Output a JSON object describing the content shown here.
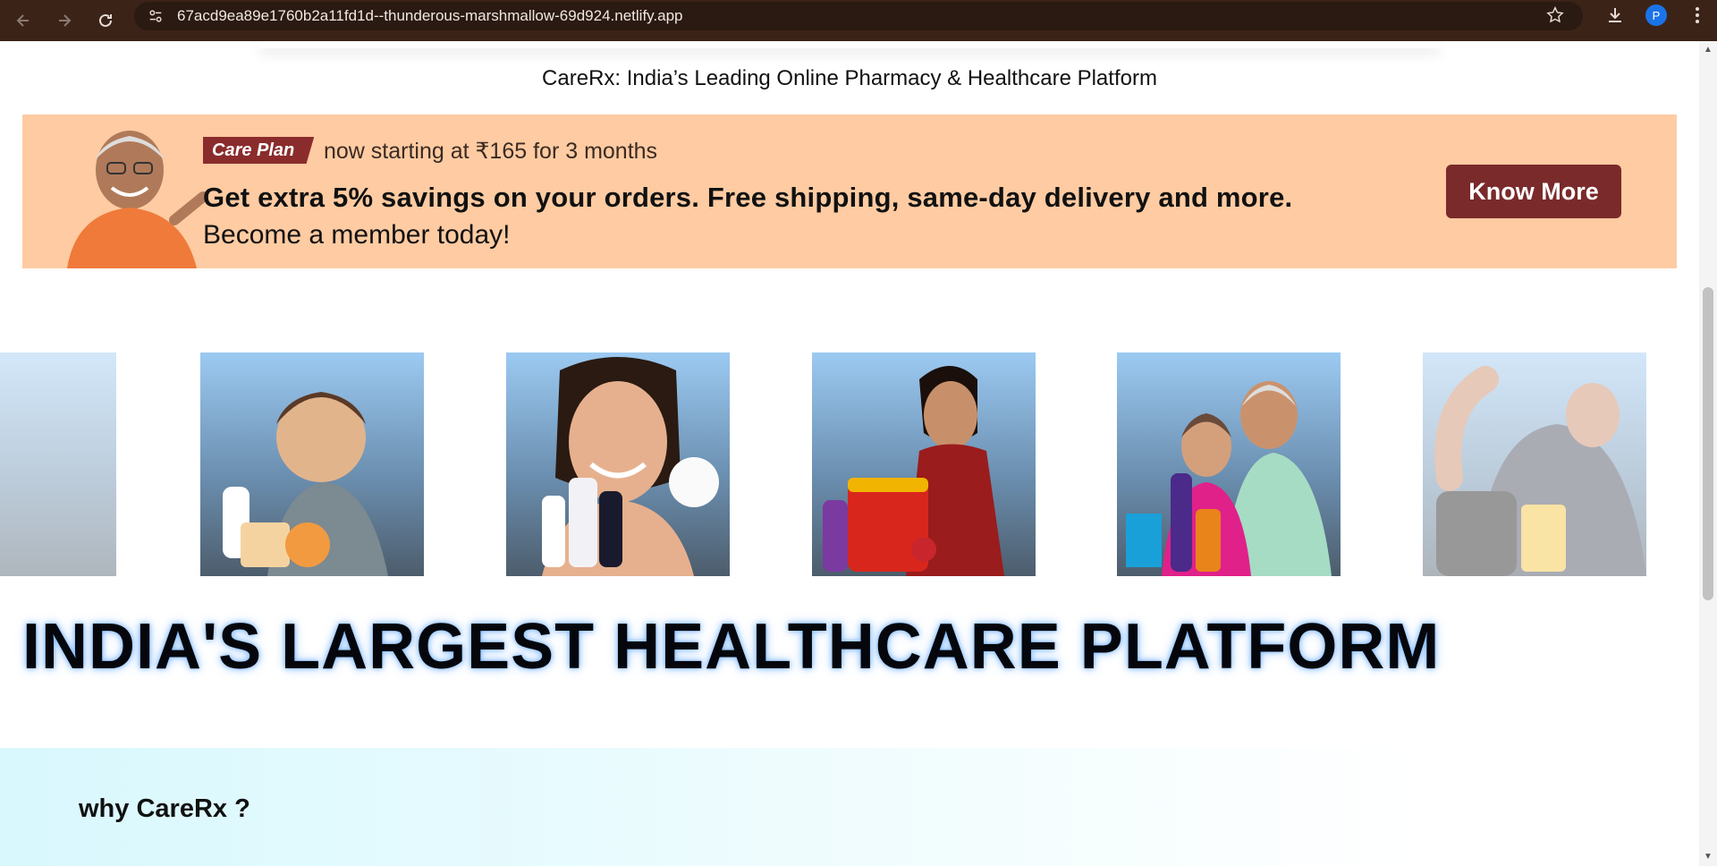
{
  "browser": {
    "url": "67acd9ea89e1760b2a11fd1d--thunderous-marshmallow-69d924.netlify.app",
    "profile_initial": "P"
  },
  "page": {
    "tagline": "CareRx: India’s Leading Online Pharmacy & Healthcare Platform",
    "promo": {
      "badge": "Care Plan",
      "starting": "now starting at ₹165 for 3 months",
      "headline": "Get extra 5% savings on your orders. Free shipping, same-day delivery and more.",
      "subline": "Become a member today!",
      "cta": "Know More"
    },
    "carousel": {
      "cards": [
        {
          "name": "baby-care"
        },
        {
          "name": "skin-care"
        },
        {
          "name": "nutrition"
        },
        {
          "name": "elderly-care"
        },
        {
          "name": "fitness"
        }
      ]
    },
    "hero_title": "INDIA'S LARGEST HEALTHCARE PLATFORM",
    "why_title": "why CareRx ?"
  },
  "colors": {
    "chrome_bg": "#3b2318",
    "promo_bg": "#ffcba2",
    "badge_bg": "#8b2c2c",
    "cta_bg": "#7a2a2a"
  }
}
